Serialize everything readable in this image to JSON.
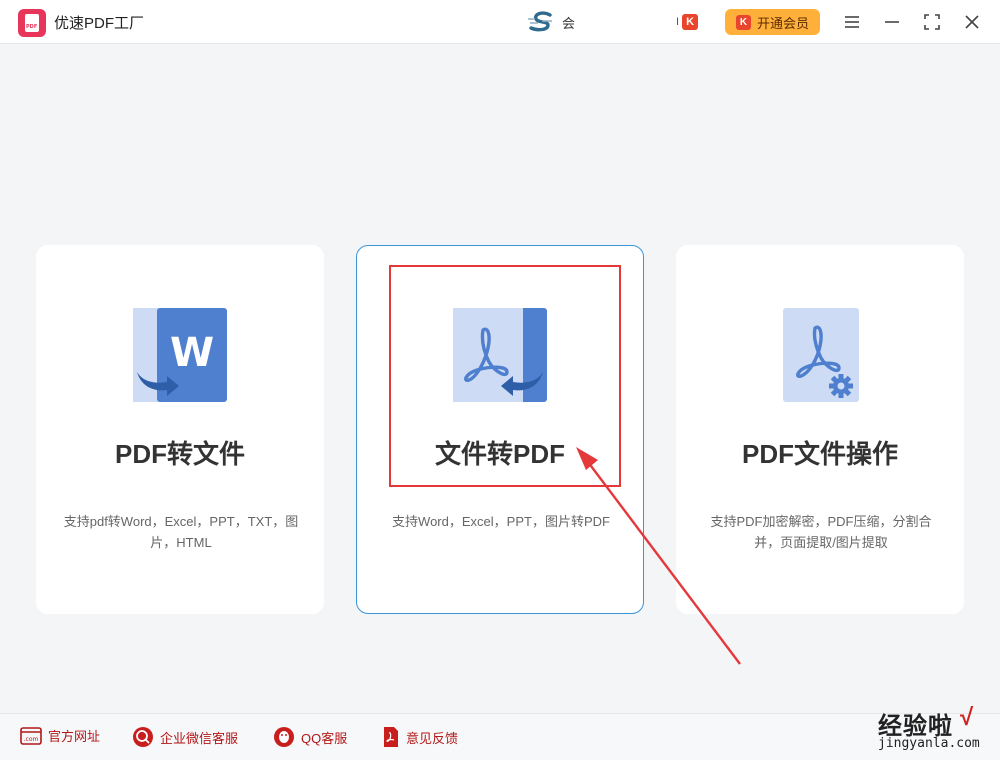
{
  "titlebar": {
    "app_name": "优速PDF工厂",
    "logo_text": "PDF",
    "user_name": "会",
    "mini_badge_prefix": "I",
    "vip_k": "K",
    "vip_button_label": "开通会员"
  },
  "cards": [
    {
      "title": "PDF转文件",
      "desc": "支持pdf转Word，Excel，PPT，TXT，图片，HTML",
      "icon": "word-document-icon"
    },
    {
      "title": "文件转PDF",
      "desc": "支持Word，Excel，PPT，图片转PDF",
      "icon": "pdf-document-icon"
    },
    {
      "title": "PDF文件操作",
      "desc": "支持PDF加密解密，PDF压缩，分割合并，页面提取/图片提取",
      "icon": "pdf-settings-icon"
    }
  ],
  "footer": {
    "items": [
      {
        "label": "官方网址",
        "icon": "website-icon"
      },
      {
        "label": "企业微信客服",
        "icon": "wechat-service-icon"
      },
      {
        "label": "QQ客服",
        "icon": "qq-icon"
      },
      {
        "label": "意见反馈",
        "icon": "feedback-icon"
      }
    ]
  },
  "watermark": {
    "top": "经验啦",
    "check": "√",
    "bottom": "jingyanla.com"
  },
  "colors": {
    "accent_blue": "#4f7fcf",
    "card_border_active": "#3a95d8",
    "annotation_red": "#e5383b",
    "vip_orange": "#ffb03b",
    "footer_text": "#b21818"
  }
}
